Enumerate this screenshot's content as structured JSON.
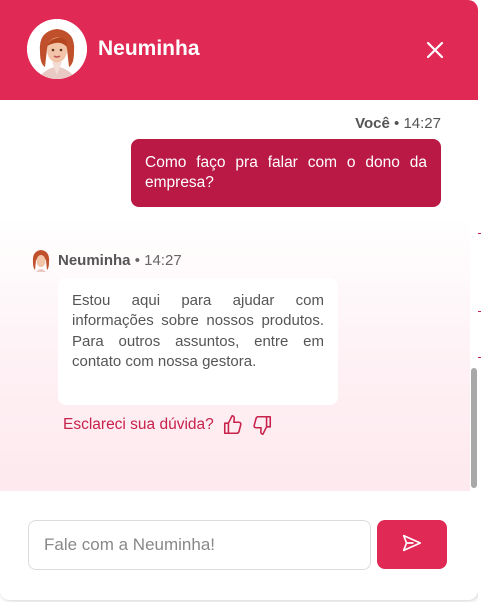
{
  "header": {
    "title": "Neuminha",
    "close_icon": "close-icon",
    "color": "#e02a55"
  },
  "messages": [
    {
      "sender": "Você",
      "time": "14:27",
      "text": "Como faço pra falar com o dono da empresa?"
    },
    {
      "sender": "Neuminha",
      "time": "14:27",
      "text": "Estou aqui para ajudar com informações sobre nossos produtos. Para outros assuntos, entre em contato com nossa gestora."
    }
  ],
  "feedback": {
    "question": "Esclareci sua dúvida?",
    "up_icon": "thumbs-up-icon",
    "down_icon": "thumbs-down-icon"
  },
  "composer": {
    "placeholder": "Fale com a Neuminha!",
    "value": "",
    "send_icon": "send-icon"
  },
  "colors": {
    "accent": "#e02a55",
    "user_bubble": "#b91944",
    "feedback_text": "#c8214b"
  },
  "separator": "•"
}
